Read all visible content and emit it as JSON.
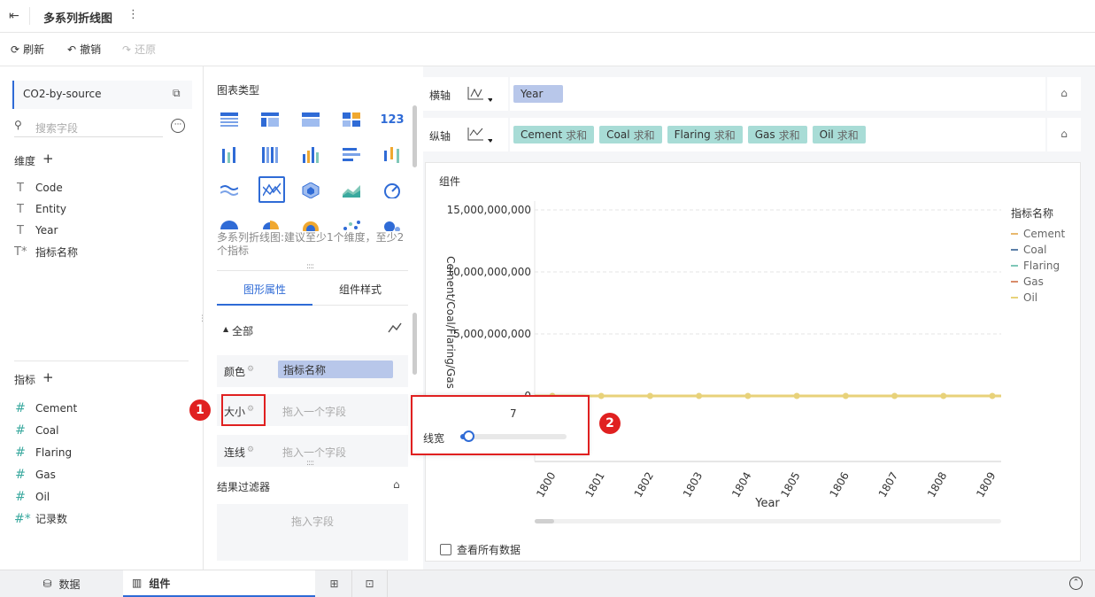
{
  "header": {
    "title": "多系列折线图"
  },
  "toolbar": {
    "refresh": "刷新",
    "undo": "撤销",
    "redo": "还原"
  },
  "dataset": {
    "name": "CO2-by-source",
    "search_placeholder": "搜索字段"
  },
  "dimensions": {
    "title": "维度",
    "items": [
      "Code",
      "Entity",
      "Year",
      "指标名称"
    ]
  },
  "measures": {
    "title": "指标",
    "items": [
      "Cement",
      "Coal",
      "Flaring",
      "Gas",
      "Oil",
      "记录数"
    ]
  },
  "chart_type": {
    "title": "图表类型",
    "hint": "多系列折线图:建议至少1个维度，至少2个指标"
  },
  "props": {
    "tab1": "图形属性",
    "tab2": "组件样式",
    "all": "全部",
    "color": "颜色",
    "color_field": "指标名称",
    "size": "大小",
    "size_placeholder": "拖入一个字段",
    "line": "连线",
    "line_placeholder": "拖入一个字段",
    "filter_title": "结果过滤器",
    "filter_placeholder": "拖入字段"
  },
  "popup": {
    "value": "7",
    "label": "线宽",
    "level": 0.05
  },
  "axes": {
    "x_label": "横轴",
    "y_label": "纵轴",
    "x_field": "Year",
    "y_fields": [
      {
        "name": "Cement",
        "agg": "求和"
      },
      {
        "name": "Coal",
        "agg": "求和"
      },
      {
        "name": "Flaring",
        "agg": "求和"
      },
      {
        "name": "Gas",
        "agg": "求和"
      },
      {
        "name": "Oil",
        "agg": "求和"
      }
    ]
  },
  "component": {
    "title": "组件",
    "view_all": "查看所有数据"
  },
  "legend": {
    "title": "指标名称",
    "items": [
      {
        "name": "Cement",
        "color": "#e8b86d"
      },
      {
        "name": "Coal",
        "color": "#5b7fa8"
      },
      {
        "name": "Flaring",
        "color": "#7fc7b8"
      },
      {
        "name": "Gas",
        "color": "#d98c6a"
      },
      {
        "name": "Oil",
        "color": "#e8d27a"
      }
    ]
  },
  "chart_data": {
    "type": "line",
    "x": [
      "1800",
      "1801",
      "1802",
      "1803",
      "1804",
      "1805",
      "1806",
      "1807",
      "1808",
      "1809"
    ],
    "series": [
      {
        "name": "Oil",
        "values": [
          0,
          0,
          0,
          0,
          0,
          0,
          0,
          0,
          0,
          0
        ]
      }
    ],
    "ylabel": "Cement/Coal/Flaring/Gas",
    "xlabel": "Year",
    "yticks": [
      "15,000,000,000",
      "10,000,000,000",
      "5,000,000,000",
      "0"
    ],
    "ylim": [
      0,
      15000000000
    ]
  },
  "annotations": {
    "one": "1",
    "two": "2"
  },
  "bottom_tabs": {
    "data": "数据",
    "component": "组件"
  }
}
